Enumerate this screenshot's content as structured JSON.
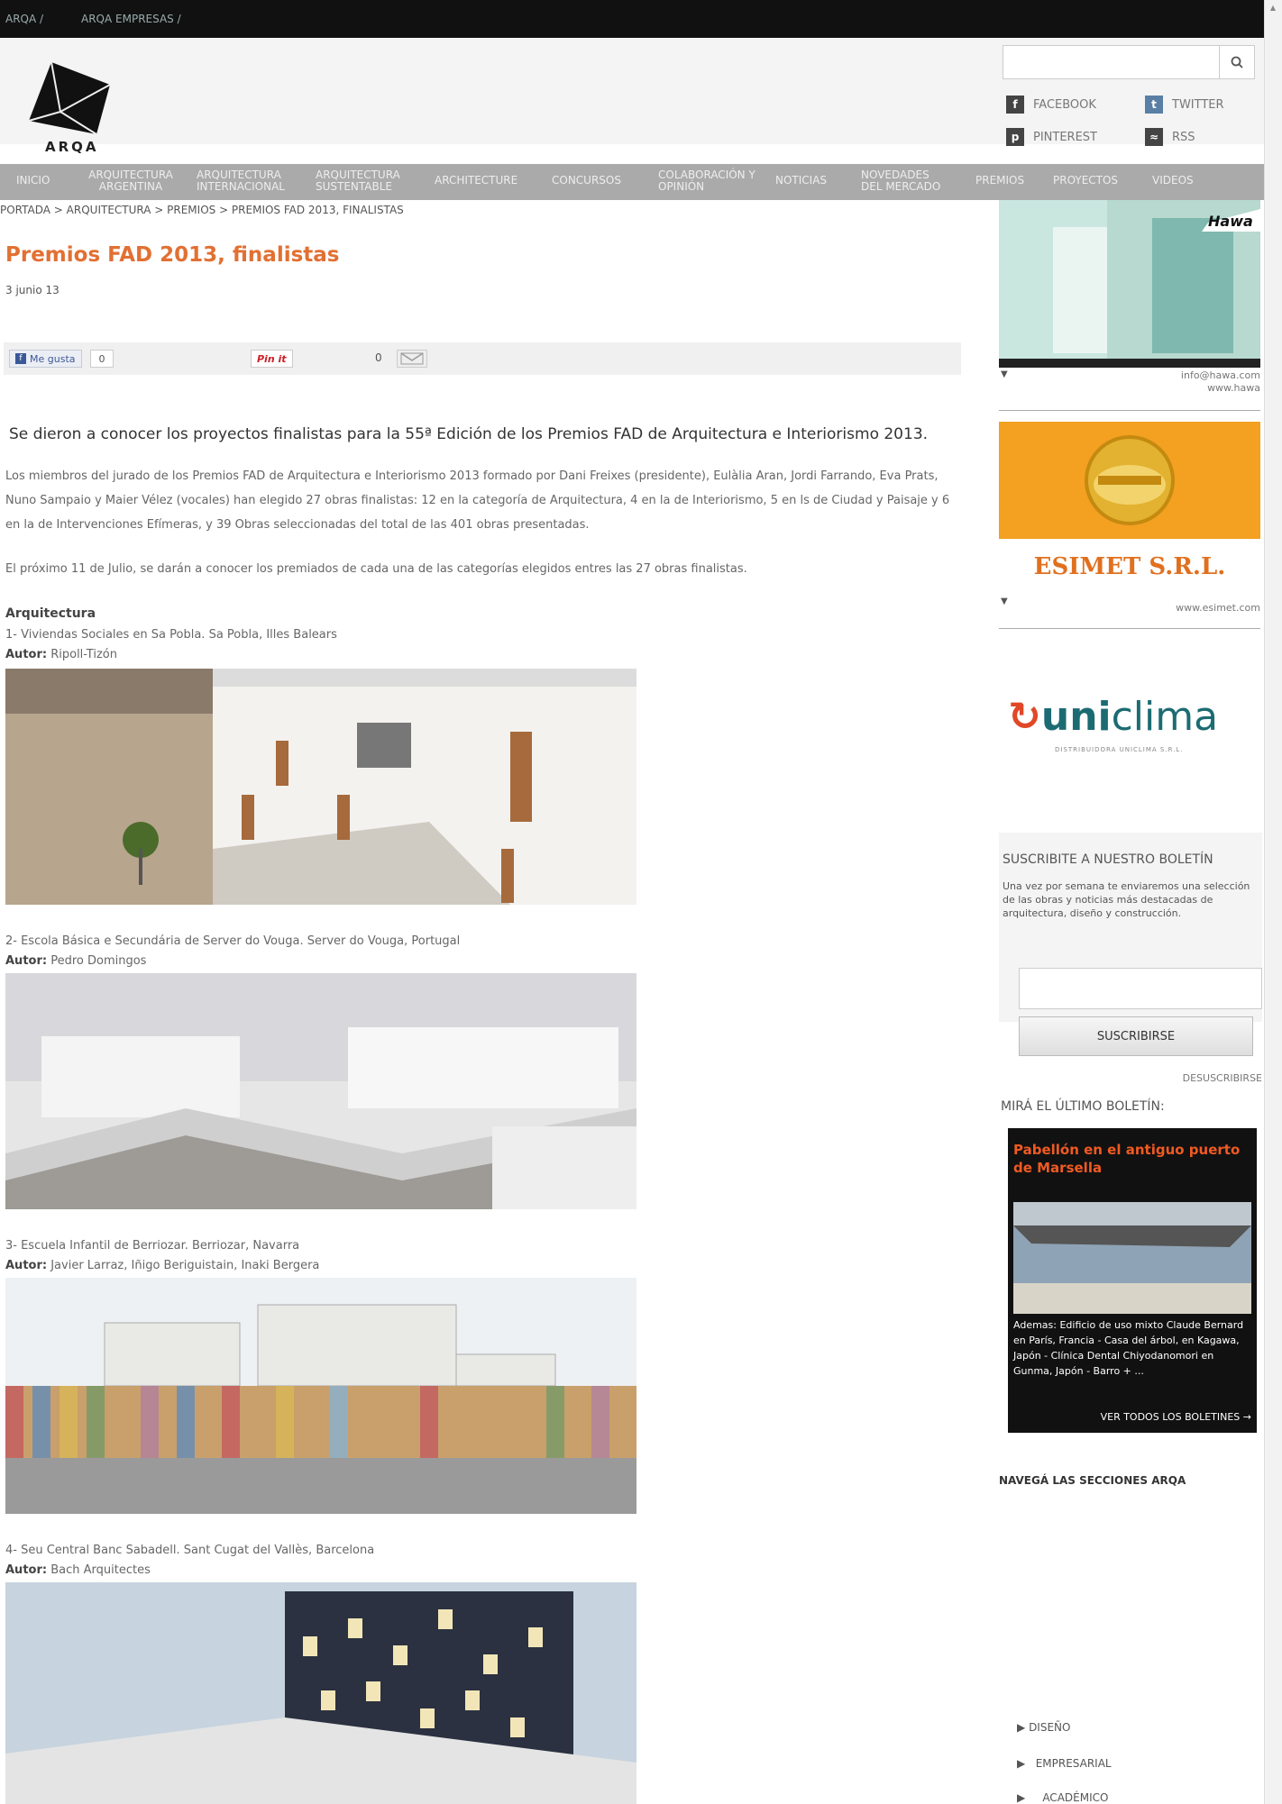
{
  "topbar": {
    "items": [
      "ARQA /",
      "ARQA EMPRESAS /"
    ]
  },
  "logo": {
    "text": "ARQA"
  },
  "search": {
    "placeholder": ""
  },
  "social": {
    "facebook": "FACEBOOK",
    "twitter": "TWITTER",
    "pinterest": "PINTEREST",
    "rss": "RSS"
  },
  "nav": {
    "items": [
      "INICIO",
      "ARQUITECTURA ARGENTINA",
      "ARQUITECTURA INTERNACIONAL",
      "ARQUITECTURA SUSTENTABLE",
      "ARCHITECTURE",
      "CONCURSOS",
      "COLABORACIÓN Y OPINIÓN",
      "NOTICIAS",
      "NOVEDADES DEL MERCADO",
      "PREMIOS",
      "PROYECTOS",
      "VIDEOS"
    ]
  },
  "breadcrumb": "PORTADA > ARQUITECTURA > PREMIOS > PREMIOS FAD 2013, FINALISTAS",
  "article": {
    "title": "Premios FAD 2013, finalistas",
    "date": "3 junio 13",
    "share": {
      "like": "Me gusta",
      "like_count": "0",
      "pin": "Pin it",
      "mail_count": "0"
    },
    "lede": "Se dieron a conocer los proyectos finalistas para la 55ª Edición de los Premios FAD de Arquitectura e Interiorismo 2013.",
    "p1": "Los miembros del jurado de los Premios FAD de Arquitectura e Interiorismo 2013 formado por Dani Freixes (presidente), Eulàlia Aran, Jordi Farrando, Eva Prats, Nuno Sampaio y Maier Vélez (vocales) han elegido 27 obras finalistas: 12 en la categoría de Arquitectura, 4 en la de Interiorismo, 5 en ls de Ciudad y Paisaje y 6 en la de Intervenciones Efímeras, y 39 Obras seleccionadas del total de las 401 obras presentadas.",
    "p2": "El próximo 11 de Julio, se darán a conocer los premiados de cada una de las categorías elegidos entres las 27 obras finalistas.",
    "section": "Arquitectura",
    "author_label": "Autor:",
    "items": [
      {
        "title": "1- Viviendas Sociales en Sa Pobla. Sa Pobla, Illes Balears",
        "author": "Ripoll-Tizón"
      },
      {
        "title": "2- Escola Básica e Secundária de Server do Vouga. Server do Vouga, Portugal",
        "author": "Pedro Domingos"
      },
      {
        "title": "3- Escuela Infantil de Berriozar. Berriozar, Navarra",
        "author": "Javier Larraz, Iñigo Beriguistain, Inaki Bergera"
      },
      {
        "title": "4- Seu Central Banc Sabadell. Sant Cugat del Vallès, Barcelona",
        "author": "Bach Arquitectes"
      }
    ]
  },
  "sidebar": {
    "ad1": {
      "brand": "Hawa",
      "contact1": "info@hawa.com",
      "contact2": "www.hawa"
    },
    "ad2": {
      "brand": "ESIMET S.R.L.",
      "url": "www.esimet.com"
    },
    "ad3": {
      "brand_a": "uni",
      "brand_b": "clima",
      "sub": "DISTRIBUIDORA UNICLIMA S.R.L."
    },
    "newsletter": {
      "title": "SUSCRIBITE A NUESTRO BOLETÍN",
      "text": "Una vez por semana te enviaremos una selección de las obras y noticias más destacadas de arquitectura, diseño y construcción.",
      "button": "SUSCRIBIRSE",
      "unsubscribe": "DESUSCRIBIRSE",
      "last": "MIRÁ EL ÚLTIMO BOLETÍN:"
    },
    "bulletin": {
      "title": "Pabellón en el antiguo puerto de Marsella",
      "text": "Ademas: Edificio de uso mixto Claude Bernard en París, Francia - Casa del árbol, en Kagawa, Japón - Clínica Dental Chiyodanomori en Gunma, Japón - Barro + ...",
      "link": "VER TODOS LOS BOLETINES →"
    },
    "sections_title": "NAVEGÁ LAS SECCIONES ARQA",
    "sections": [
      "DISEÑO",
      "EMPRESARIAL",
      "ACADÉMICO"
    ]
  }
}
